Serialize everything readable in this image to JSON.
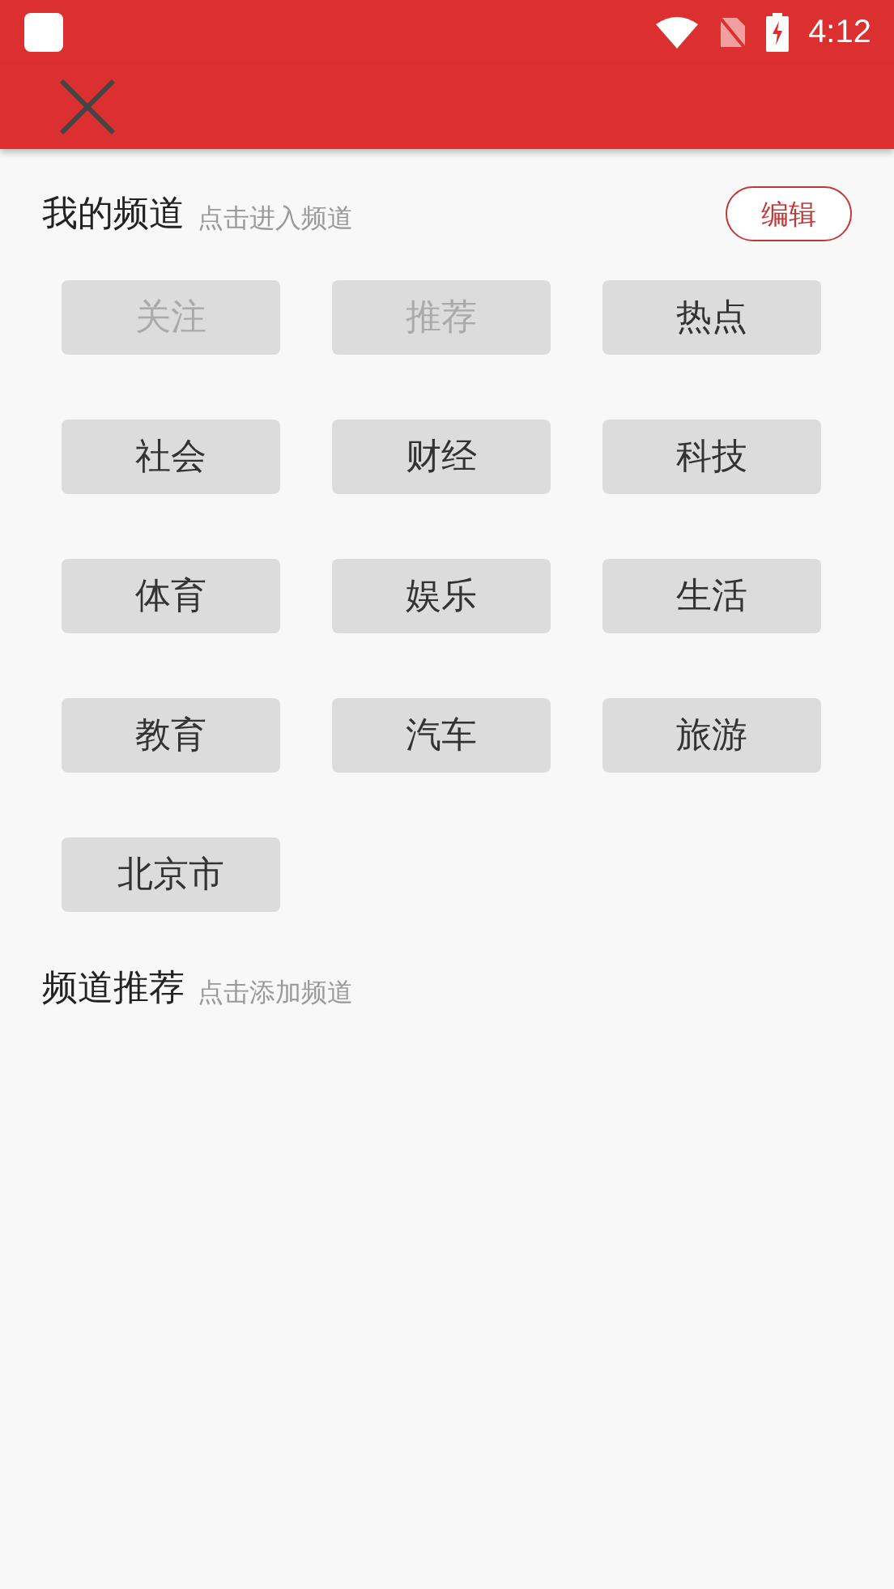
{
  "status_bar": {
    "time": "4:12"
  },
  "my_channels": {
    "title": "我的频道",
    "hint": "点击进入频道",
    "edit_button": "编辑",
    "items": [
      {
        "label": "关注",
        "disabled": true
      },
      {
        "label": "推荐",
        "disabled": true
      },
      {
        "label": "热点",
        "disabled": false
      },
      {
        "label": "社会",
        "disabled": false
      },
      {
        "label": "财经",
        "disabled": false
      },
      {
        "label": "科技",
        "disabled": false
      },
      {
        "label": "体育",
        "disabled": false
      },
      {
        "label": "娱乐",
        "disabled": false
      },
      {
        "label": "生活",
        "disabled": false
      },
      {
        "label": "教育",
        "disabled": false
      },
      {
        "label": "汽车",
        "disabled": false
      },
      {
        "label": "旅游",
        "disabled": false
      },
      {
        "label": "北京市",
        "disabled": false
      }
    ]
  },
  "recommended": {
    "title": "频道推荐",
    "hint": "点击添加频道"
  }
}
